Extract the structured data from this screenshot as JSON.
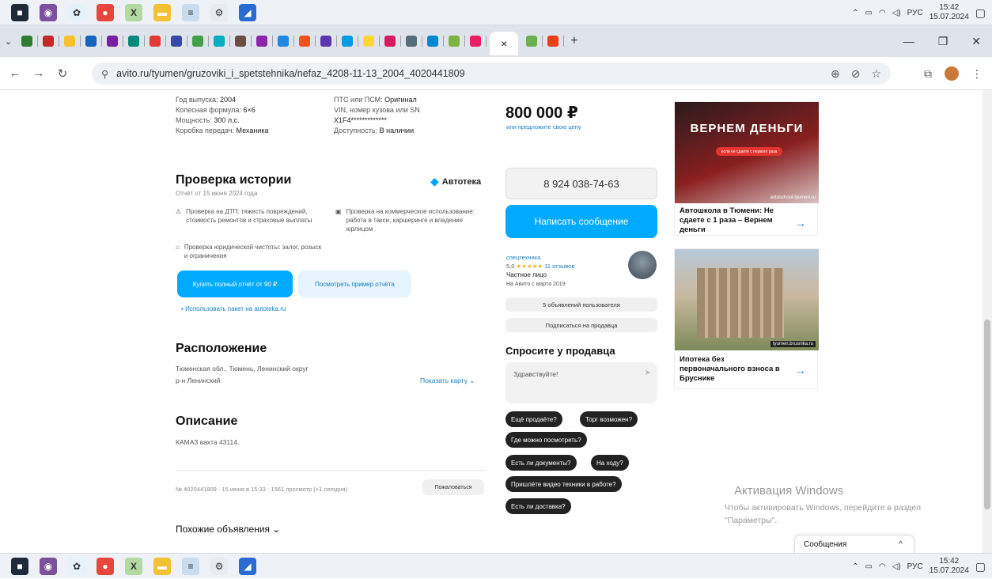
{
  "taskbar": {
    "apps": [
      {
        "name": "windows-start-icon",
        "color": "#1e2a38",
        "glyph": "■"
      },
      {
        "name": "viber-icon",
        "color": "#7b519d",
        "glyph": "◉"
      },
      {
        "name": "vpn-icon",
        "color": "#e6f2f9",
        "glyph": "✿"
      },
      {
        "name": "chrome-icon",
        "color": "#e8453c",
        "glyph": "●"
      },
      {
        "name": "excel-icon",
        "color": "#b3d9a3",
        "glyph": "X"
      },
      {
        "name": "file-explorer-icon",
        "color": "#f2c232",
        "glyph": "▬"
      },
      {
        "name": "docs-icon",
        "color": "#c7dcee",
        "glyph": "≡"
      },
      {
        "name": "settings-icon",
        "color": "#e8ebef",
        "glyph": "⚙"
      },
      {
        "name": "app-icon",
        "color": "#2a6bd1",
        "glyph": "◢"
      }
    ],
    "lang": "РУС",
    "time": "15:42",
    "date": "15.07.2024"
  },
  "browser": {
    "url": "avito.ru/tyumen/gruzoviki_i_spetstehnika/nefaz_4208-11-13_2004_4020441809",
    "tab_close": "×",
    "new_tab": "+"
  },
  "specs": {
    "col1": [
      {
        "label": "Год выпуска:",
        "value": "2004"
      },
      {
        "label": "Колесная формула:",
        "value": "6×6"
      },
      {
        "label": "Мощность:",
        "value": "300 л.с."
      },
      {
        "label": "Коробка передач:",
        "value": "Механика"
      }
    ],
    "col2": [
      {
        "label": "ПТС или ПСМ:",
        "value": "Оригинал"
      },
      {
        "label": "VIN, номер кузова или SN",
        "value": "X1F4*************"
      },
      {
        "label": "Доступность:",
        "value": "В наличии"
      }
    ]
  },
  "history": {
    "title": "Проверка истории",
    "subtitle": "Отчёт от 15 июня 2024 года",
    "brand": "Автотека",
    "item1": "Проверка на ДТП: тяжесть повреждений, стоимость ремонтов и страховые выплаты",
    "item2": "Проверка на коммерческое использование: работа в такси, каршеринге и владение юрлицом",
    "item3": "Проверка юридической чистоты: залог, розыск и ограничения",
    "buy_button": "Купить полный отчёт от 90 ₽",
    "sample_button": "Посмотреть пример отчёта",
    "package_link": "Использовать пакет на autoteka.ru"
  },
  "location": {
    "title": "Расположение",
    "address": "Тюменская обл., Тюмень, Ленинский округ",
    "district": "р-н Ленинский",
    "map_link": "Показать карту"
  },
  "description": {
    "title": "Описание",
    "text": "КАМАЗ вахта 43114."
  },
  "meta": {
    "text": "№ 4020441809 · 15 июня в 15:33 · 1561 просмотр (+1 сегодня)",
    "complain": "Пожаловаться"
  },
  "similar": {
    "label": "Похожие объявления ⌄"
  },
  "seller": {
    "price": "800 000 ₽",
    "offer_link": "или предложите свою цену",
    "phone": "8 924 038-74-63",
    "message_button": "Написать сообщение",
    "name": "спецтехника",
    "rating": "5,0",
    "stars": "★★★★★",
    "reviews": "11 отзывов",
    "type": "Частное лицо",
    "since": "На Авито с марта 2019",
    "ads_button": "5 объявлений пользователя",
    "subscribe_button": "Подписаться на продавца"
  },
  "ask": {
    "title": "Спросите у продавца",
    "input_value": "Здравствуйте!",
    "chips": [
      "Ещё продаёте?",
      "Торг возможен?",
      "Где можно посмотреть?",
      "Есть ли документы?",
      "На ходу?",
      "Пришлёте видео техники в работе?",
      "Есть ли доставка?"
    ]
  },
  "ads": {
    "ad1_banner": "ВЕРНЕМ ДЕНЬГИ",
    "ad1_sub": "если не сдаете с первого раза",
    "ad1_site": "avtoschool-tyumen.ru",
    "ad1_text": "Автошкола в Тюмени: Не сдаете с 1 раза – Вернем деньги",
    "ad2_site": "tyumen.brusnika.ru",
    "ad2_text": "Ипотека без первоначального взноса в Брусникe",
    "arrow": "→"
  },
  "windows": {
    "title": "Активация Windows",
    "sub": "Чтобы активировать Windows, перейдите в раздел \"Параметры\"."
  },
  "messages_popup": {
    "label": "Сообщения",
    "chevron": "^"
  }
}
